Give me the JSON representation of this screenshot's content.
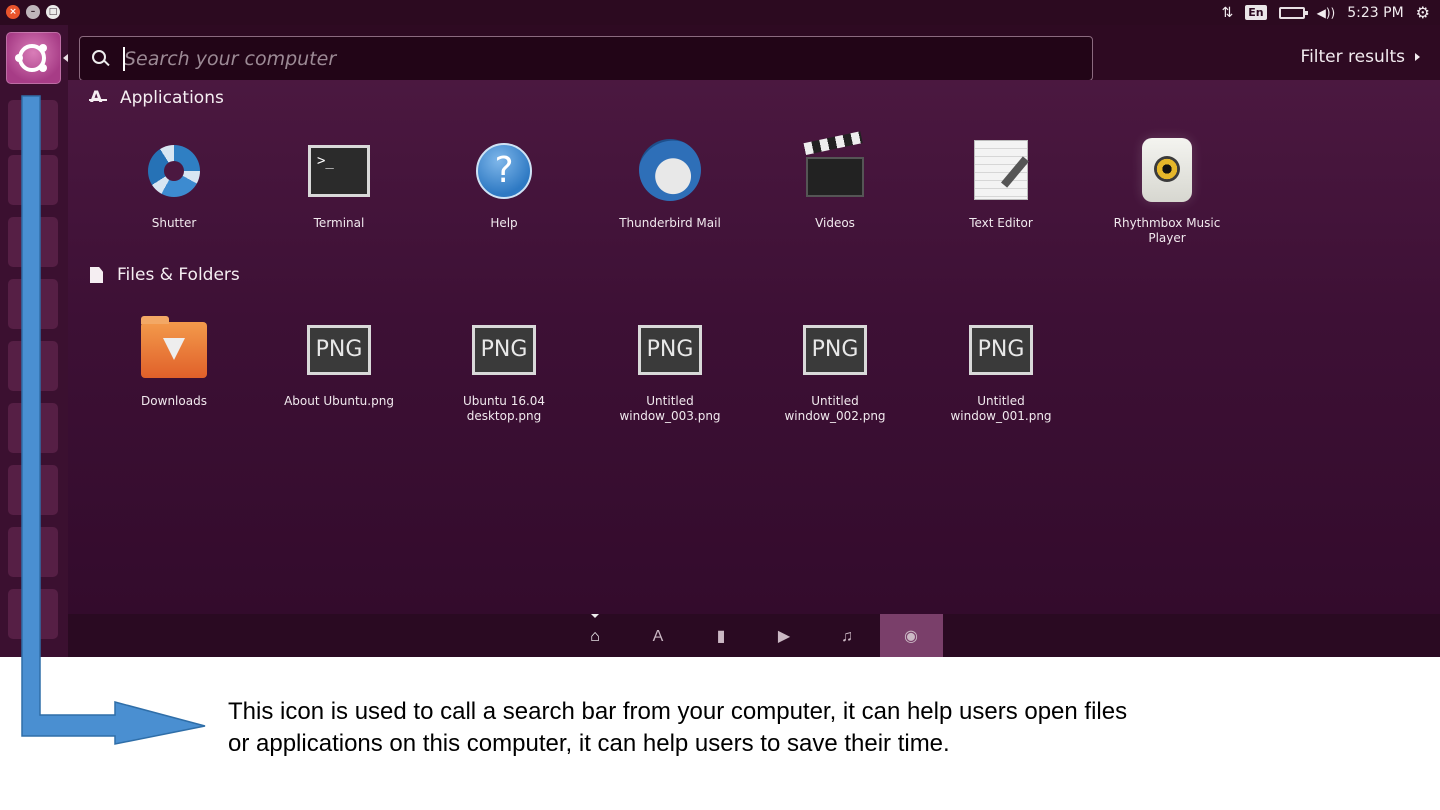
{
  "window_controls": {
    "close": "×",
    "minimize": "–",
    "maximize": "□"
  },
  "top_panel": {
    "keyboard_layout": "En",
    "time": "5:23 PM",
    "volume_glyph": "◀))",
    "network_glyph": "⇅",
    "settings_glyph": "⚙"
  },
  "search": {
    "placeholder": "Search your computer",
    "value": ""
  },
  "filter_results_label": "Filter results",
  "sections": {
    "applications": {
      "title": "Applications",
      "items": [
        {
          "label": "Shutter",
          "icon": "shutter-icon"
        },
        {
          "label": "Terminal",
          "icon": "terminal-icon"
        },
        {
          "label": "Help",
          "icon": "help-icon"
        },
        {
          "label": "Thunderbird Mail",
          "icon": "thunderbird-icon"
        },
        {
          "label": "Videos",
          "icon": "videos-icon"
        },
        {
          "label": "Text Editor",
          "icon": "text-editor-icon"
        },
        {
          "label": "Rhythmbox Music Player",
          "icon": "rhythmbox-icon"
        }
      ]
    },
    "files_folders": {
      "title": "Files & Folders",
      "items": [
        {
          "label": "Downloads",
          "icon": "folder-download-icon"
        },
        {
          "label": "About Ubuntu.png",
          "icon": "png-file-icon",
          "badge": "PNG"
        },
        {
          "label": "Ubuntu 16.04 desktop.png",
          "icon": "png-file-icon",
          "badge": "PNG"
        },
        {
          "label": "Untitled window_003.png",
          "icon": "png-file-icon",
          "badge": "PNG"
        },
        {
          "label": "Untitled window_002.png",
          "icon": "png-file-icon",
          "badge": "PNG"
        },
        {
          "label": "Untitled window_001.png",
          "icon": "png-file-icon",
          "badge": "PNG"
        }
      ]
    }
  },
  "lens_bar": {
    "lenses": [
      {
        "name": "home-lens-icon",
        "glyph": "⌂",
        "active": true
      },
      {
        "name": "applications-lens-icon",
        "glyph": "A",
        "active": false
      },
      {
        "name": "files-lens-icon",
        "glyph": "▮",
        "active": false
      },
      {
        "name": "video-lens-icon",
        "glyph": "▶",
        "active": false
      },
      {
        "name": "music-lens-icon",
        "glyph": "♫",
        "active": false
      },
      {
        "name": "photos-lens-icon",
        "glyph": "◉",
        "active": false,
        "highlighted": true
      }
    ]
  },
  "annotation": "This icon is used to call a search bar from your computer, it can help users open files or applications on this computer, it can help users to save their time.",
  "colors": {
    "dash_background": "#3d1035",
    "panel": "#2c0a20",
    "accent_arrow": "#4a8fd1"
  }
}
